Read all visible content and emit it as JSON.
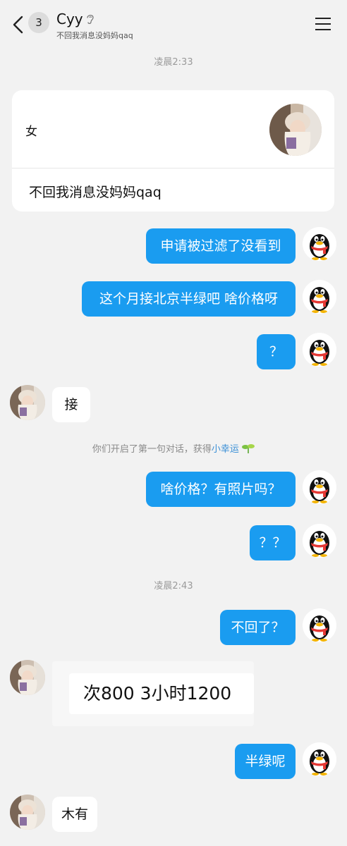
{
  "header": {
    "unread_count": "3",
    "contact_name": "Cyy",
    "contact_signature": "不回我消息没妈妈qaq"
  },
  "card": {
    "gender": "女",
    "signature": "不回我消息没妈妈qaq"
  },
  "timestamps": [
    "凌晨2:33",
    "凌晨2:43"
  ],
  "messages": [
    {
      "from": "me",
      "text": "申请被过滤了没看到"
    },
    {
      "from": "me",
      "text": "这个月接北京半绿吧 啥价格呀"
    },
    {
      "from": "me",
      "text": "？"
    },
    {
      "from": "them",
      "text": "接"
    },
    {
      "from": "me",
      "text": "啥价格？有照片吗？"
    },
    {
      "from": "me",
      "text": "？？"
    },
    {
      "from": "me",
      "text": "不回了？"
    },
    {
      "from": "them",
      "text": "次800  3小时1200"
    },
    {
      "from": "me",
      "text": "半绿呢"
    },
    {
      "from": "them",
      "text": "木有"
    }
  ],
  "system_notice": {
    "text": "你们开启了第一句对话，获得",
    "link": "小幸运"
  },
  "icons": {
    "back": "chevron-left-icon",
    "ear": "ear-icon",
    "menu": "menu-icon",
    "sprout": "sprout-icon"
  },
  "colors": {
    "outgoing_bubble": "#1a9cf0",
    "incoming_bubble": "#ffffff",
    "background": "#f2f2f2",
    "link": "#3a8fd6"
  }
}
